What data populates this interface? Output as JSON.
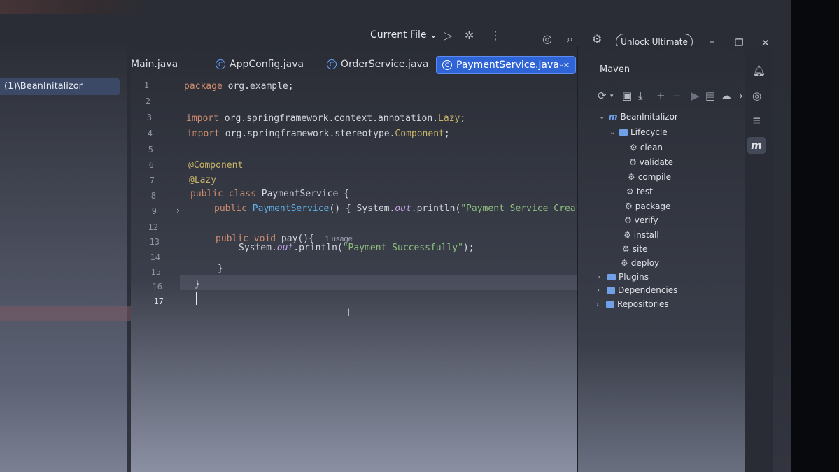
{
  "titlebar": {
    "run_config": "Current File",
    "unlock_label": "Unlock Ultimate"
  },
  "project": {
    "selected_item": "(1)\\BeanInitalizor"
  },
  "tabs": [
    {
      "label": "Main.java",
      "active": false
    },
    {
      "label": "AppConfig.java",
      "active": false
    },
    {
      "label": "OrderService.java",
      "active": false
    },
    {
      "label": "PaymentService.java",
      "active": true
    }
  ],
  "editor": {
    "line_numbers": [
      "1",
      "2",
      "3",
      "4",
      "5",
      "6",
      "7",
      "8",
      "9",
      "12",
      "13",
      "14",
      "15",
      "16",
      "17"
    ],
    "code": {
      "l1_kw": "package",
      "l1_rest": " org.example;",
      "l3_kw": "import",
      "l3_rest": " org.springframework.context.annotation.",
      "l3_typ": "Lazy",
      "l3_end": ";",
      "l4_kw": "import",
      "l4_rest": " org.springframework.stereotype.",
      "l4_typ": "Component",
      "l4_end": ";",
      "l6": "@Component",
      "l7": "@Lazy",
      "l8_kw": "public class",
      "l8_rest": " PaymentService {",
      "l9_kw": "public",
      "l9_fn": " PaymentService",
      "l9_mid": "() { System.",
      "l9_out": "out",
      "l9_call": ".println(",
      "l9_str": "\"Payment Service Created S",
      "l13_kw": "public void",
      "l13_rest": " pay(){",
      "l13_hint": "1 usage",
      "l14_pre": "System.",
      "l14_out": "out",
      "l14_call": ".println(",
      "l14_str": "\"Payment Successfully\"",
      "l14_end": ");",
      "l15": "}",
      "l16": "}"
    }
  },
  "maven": {
    "title": "Maven",
    "root": "BeanInitalizor",
    "lifecycle": "Lifecycle",
    "phases": [
      "clean",
      "validate",
      "compile",
      "test",
      "package",
      "verify",
      "install",
      "site",
      "deploy"
    ],
    "groups": [
      "Plugins",
      "Dependencies",
      "Repositories"
    ]
  },
  "colors": {
    "accent": "#2f64d6",
    "keyword": "#ce8d6d",
    "string": "#8fbf7f",
    "annotation": "#c9b36a"
  }
}
